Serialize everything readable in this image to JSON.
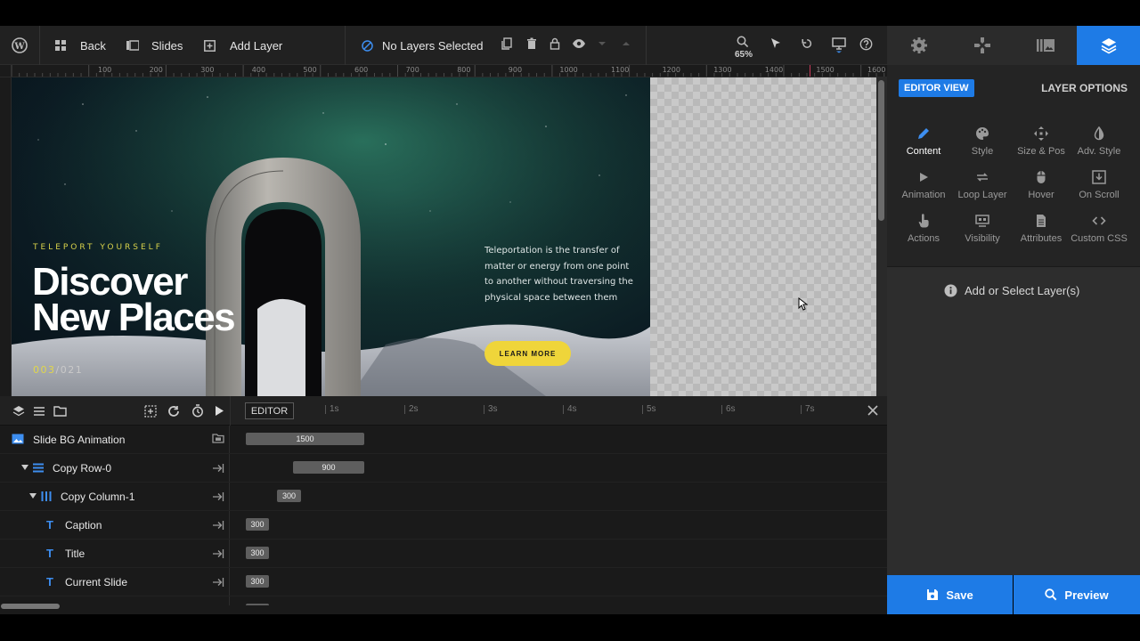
{
  "toolbar": {
    "back": "Back",
    "slides": "Slides",
    "add_layer": "Add Layer",
    "selection_status": "No Layers Selected",
    "zoom": "65%"
  },
  "ruler": {
    "labels": [
      "100",
      "200",
      "300",
      "400",
      "500",
      "600",
      "700",
      "800",
      "900",
      "1000",
      "1100",
      "1200",
      "1300",
      "1400",
      "1500",
      "1600"
    ]
  },
  "slide": {
    "caption": "TELEPORT YOURSELF",
    "title_line1": "Discover",
    "title_line2": "New Places",
    "current_slide": "003",
    "total_slides": "/021",
    "description": "Teleportation is the transfer of matter or energy from one point to another without traversing the physical space between them",
    "button_label": "LEARN MORE"
  },
  "timeline": {
    "editor_tab": "EDITOR",
    "ticks": [
      "1s",
      "2s",
      "3s",
      "4s",
      "5s",
      "6s",
      "7s"
    ],
    "rows": [
      {
        "label": "Slide BG Animation",
        "duration": "1500"
      },
      {
        "label": "Copy Row-0",
        "duration": "900"
      },
      {
        "label": "Copy Column-1",
        "duration": "300"
      },
      {
        "label": "Caption",
        "duration": "300"
      },
      {
        "label": "Title",
        "duration": "300"
      },
      {
        "label": "Current Slide",
        "duration": "300"
      }
    ]
  },
  "panel": {
    "editor_view": "EDITOR VIEW",
    "layer_options": "LAYER OPTIONS",
    "options": [
      {
        "label": "Content",
        "icon": "pencil-icon"
      },
      {
        "label": "Style",
        "icon": "palette-icon"
      },
      {
        "label": "Size & Pos",
        "icon": "move-icon"
      },
      {
        "label": "Adv. Style",
        "icon": "contrast-icon"
      },
      {
        "label": "Animation",
        "icon": "play-icon"
      },
      {
        "label": "Loop Layer",
        "icon": "loop-icon"
      },
      {
        "label": "Hover",
        "icon": "mouse-icon"
      },
      {
        "label": "On Scroll",
        "icon": "scroll-download-icon"
      },
      {
        "label": "Actions",
        "icon": "pointer-hand-icon"
      },
      {
        "label": "Visibility",
        "icon": "visibility-icon"
      },
      {
        "label": "Attributes",
        "icon": "document-icon"
      },
      {
        "label": "Custom CSS",
        "icon": "code-icon"
      }
    ],
    "add_select": "Add or Select Layer(s)",
    "save": "Save",
    "preview": "Preview"
  },
  "colors": {
    "accent": "#1e7be6",
    "button_yellow": "#efd53a",
    "caption_yellow": "#d8d24a"
  }
}
